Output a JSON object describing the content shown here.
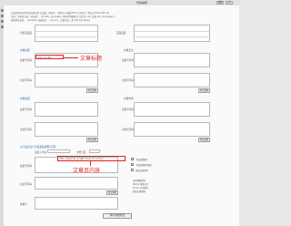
{
  "window": {
    "title": "代码编辑",
    "buttons": [
      "设置",
      "×"
    ]
  },
  "notes": {
    "line1": "完成前的时刻时间各局项全部 已设置，网址名、不要 同一模板(HCF) 在页面上 不超过 #m#cs#k 0s",
    "line2": "注意：列表页当前 一些标签 ：{pv:list} {pv:page} 等标签到模板不 已是 的一/gl, 页面, 0s/ {pv:page:1}",
    "line3": "原始地址标签： {pv:title} 页面标签 ... {pv:vt}，页面生成，源 为不 {pv:base}"
  },
  "list_page": {
    "left_label": "列表页设置",
    "right_label": "页面设置"
  },
  "sections": {
    "title_rules": "文章标题",
    "content_rules": "文章正文",
    "paging": "文章分页",
    "source_rules": "文章来源",
    "author_rules": "文章作者",
    "field_rules": "以下是自定义字段采集规则(可选)"
  },
  "labels": {
    "start": "开始",
    "end": "结束",
    "start_str": "起始字符串",
    "end_str": "结束字符串",
    "filter": "过滤规则",
    "filter_str": "过滤字符串",
    "custom": "自定义字段",
    "regex_replace": "正则替换",
    "replace_to": "替换为"
  },
  "buttons": {
    "test": "测试规则",
    "save": "保存/测试修改"
  },
  "title_rule_code": "<h1>{*}</h1>",
  "content_rule_code": "<div class=\"a1 yright line\">{*}</div>",
  "annotations": {
    "title": "文章标题",
    "content": "文章页内容"
  },
  "options": {
    "opt1": "下载远程图片",
    "opt2": "下载远程附件图片",
    "opt3": "采集远程附件"
  },
  "regex_help": {
    "line1": "正则替换说明",
    "line2": "Words 替换中文",
    "line3": "tt.com 可替换为",
    "line4": "使用正则替换"
  },
  "colors": {
    "annotation_red": "#e02020",
    "link_blue": "#2a5fa8"
  }
}
